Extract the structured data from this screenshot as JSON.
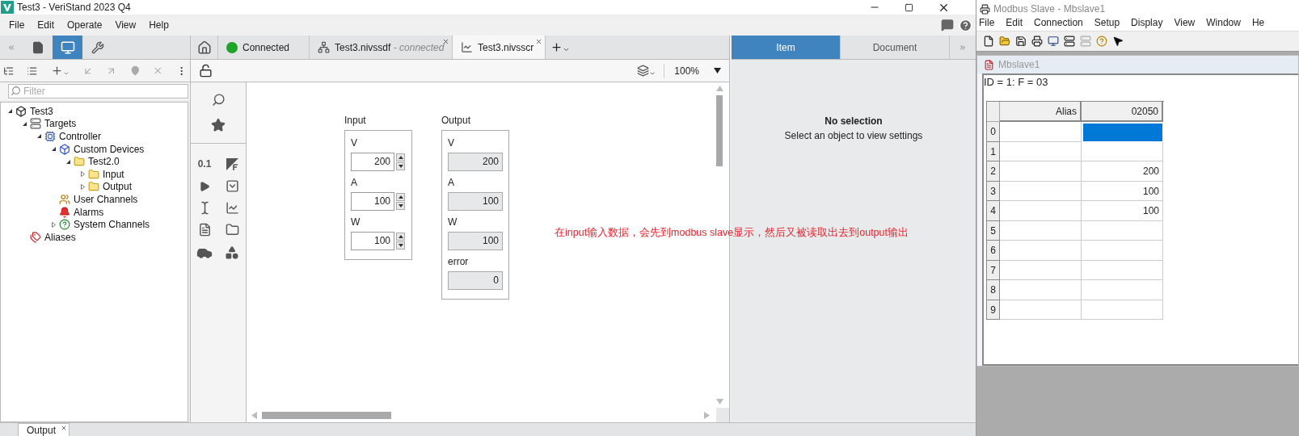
{
  "window": {
    "title": "Test3 - VeriStand 2023 Q4"
  },
  "menu": [
    "File",
    "Edit",
    "Operate",
    "View",
    "Help"
  ],
  "left_panel": {
    "tabs": [
      {
        "kind": "document",
        "selected": false
      },
      {
        "kind": "screen",
        "selected": true
      },
      {
        "kind": "tools",
        "selected": false
      }
    ],
    "filter": {
      "placeholder": "Filter"
    },
    "tree": [
      {
        "label": "Test3",
        "kind": "project",
        "expanded": true,
        "children": [
          {
            "label": "Targets",
            "kind": "targets",
            "expanded": true,
            "children": [
              {
                "label": "Controller",
                "kind": "controller",
                "expanded": true,
                "children": [
                  {
                    "label": "Custom Devices",
                    "kind": "devices",
                    "expanded": true,
                    "children": [
                      {
                        "label": "Test2.0",
                        "kind": "folder",
                        "expanded": true,
                        "children": [
                          {
                            "label": "Input",
                            "kind": "folder",
                            "expanded": false
                          },
                          {
                            "label": "Output",
                            "kind": "folder",
                            "expanded": false
                          }
                        ]
                      }
                    ]
                  },
                  {
                    "label": "User Channels",
                    "kind": "user-channels"
                  },
                  {
                    "label": "Alarms",
                    "kind": "alarms"
                  },
                  {
                    "label": "System Channels",
                    "kind": "system-channels",
                    "expanded": false
                  }
                ]
              }
            ]
          },
          {
            "label": "Aliases",
            "kind": "aliases"
          }
        ]
      }
    ]
  },
  "document_tabs": [
    {
      "kind": "home",
      "closable": false,
      "selected": false
    },
    {
      "kind": "status",
      "label": "Connected",
      "color": "#1fa328",
      "closable": false,
      "selected": false
    },
    {
      "kind": "system",
      "label": "Test3.nivssdf",
      "suffix": " - connected",
      "closable": true,
      "selected": false
    },
    {
      "kind": "screen",
      "label": "Test3.nivsscr",
      "closable": true,
      "selected": true
    }
  ],
  "zoom": "100%",
  "palette": {
    "numeric_label": "0.1"
  },
  "canvas": {
    "groups": [
      {
        "title": "Input",
        "kind": "control",
        "fields": [
          {
            "label": "V",
            "value": "200"
          },
          {
            "label": "A",
            "value": "100"
          },
          {
            "label": "W",
            "value": "100"
          }
        ]
      },
      {
        "title": "Output",
        "kind": "indicator",
        "fields": [
          {
            "label": "V",
            "value": "200"
          },
          {
            "label": "A",
            "value": "100"
          },
          {
            "label": "W",
            "value": "100"
          },
          {
            "label": "error",
            "value": "0"
          }
        ]
      }
    ],
    "annotation": "在input输入数据，会先到modbus slave显示，然后又被读取出去到output输出"
  },
  "properties_panel": {
    "tabs": [
      {
        "label": "Item",
        "selected": true
      },
      {
        "label": "Document",
        "selected": false
      }
    ],
    "heading": "No selection",
    "message": "Select an object to view settings"
  },
  "bottom_tabs": [
    {
      "label": "Output",
      "closable": true
    }
  ],
  "modbus": {
    "title": "Modbus Slave - Mbslave1",
    "menu": [
      "File",
      "Edit",
      "Connection",
      "Setup",
      "Display",
      "View",
      "Window",
      "He"
    ],
    "child": {
      "title": "Mbslave1",
      "header": "ID = 1: F = 03",
      "columns": [
        "Alias",
        "02050"
      ],
      "rows": [
        {
          "index": "0",
          "selected": true
        },
        {
          "index": "1",
          "selected": false
        },
        {
          "index": "2",
          "value": "200",
          "selected": false
        },
        {
          "index": "3",
          "value": "100",
          "selected": false
        },
        {
          "index": "4",
          "value": "100",
          "selected": false
        },
        {
          "index": "5",
          "selected": false
        },
        {
          "index": "6",
          "selected": false
        },
        {
          "index": "7",
          "selected": false
        },
        {
          "index": "8",
          "selected": false
        },
        {
          "index": "9",
          "selected": false
        }
      ]
    }
  }
}
